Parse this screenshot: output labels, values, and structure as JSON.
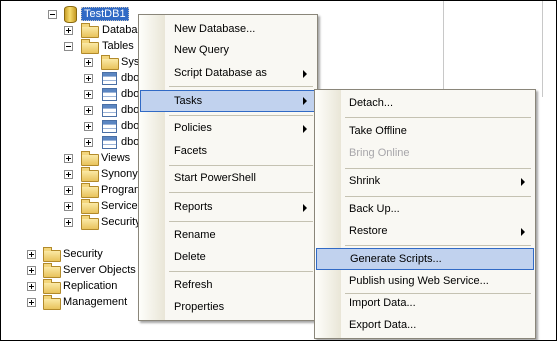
{
  "tree": {
    "db_name": "TestDB1",
    "children": [
      {
        "label": "Databa",
        "expander": "plus"
      },
      {
        "label": "Tables",
        "expander": "minus"
      },
      {
        "label": "Sys",
        "expander": "plus"
      },
      {
        "label": "dbo",
        "expander": "plus"
      },
      {
        "label": "dbo",
        "expander": "plus"
      },
      {
        "label": "dbo",
        "expander": "plus"
      },
      {
        "label": "dbo",
        "expander": "plus"
      },
      {
        "label": "dbo",
        "expander": "plus"
      },
      {
        "label": "Views",
        "expander": "plus"
      },
      {
        "label": "Synony",
        "expander": "plus"
      },
      {
        "label": "Progran",
        "expander": "plus"
      },
      {
        "label": "Service",
        "expander": "plus"
      },
      {
        "label": "Security",
        "expander": "plus"
      }
    ],
    "root_items": [
      "Security",
      "Server Objects",
      "Replication",
      "Management"
    ]
  },
  "context_menu": {
    "items": [
      {
        "label": "New Database...",
        "submenu": false,
        "highlighted": false
      },
      {
        "label": "New Query",
        "submenu": false,
        "highlighted": false
      },
      {
        "label": "Script Database as",
        "submenu": true,
        "highlighted": false
      },
      {
        "label": "Tasks",
        "submenu": true,
        "highlighted": true
      },
      {
        "label": "Policies",
        "submenu": true,
        "highlighted": false
      },
      {
        "label": "Facets",
        "submenu": false,
        "highlighted": false
      },
      {
        "label": "Start PowerShell",
        "submenu": false,
        "highlighted": false
      },
      {
        "label": "Reports",
        "submenu": true,
        "highlighted": false
      },
      {
        "label": "Rename",
        "submenu": false,
        "highlighted": false
      },
      {
        "label": "Delete",
        "submenu": false,
        "highlighted": false
      },
      {
        "label": "Refresh",
        "submenu": false,
        "highlighted": false
      },
      {
        "label": "Properties",
        "submenu": false,
        "highlighted": false
      }
    ]
  },
  "tasks_submenu": {
    "items": [
      {
        "label": "Detach...",
        "submenu": false,
        "disabled": false,
        "highlighted": false
      },
      {
        "label": "Take Offline",
        "submenu": false,
        "disabled": false,
        "highlighted": false
      },
      {
        "label": "Bring Online",
        "submenu": false,
        "disabled": true,
        "highlighted": false
      },
      {
        "label": "Shrink",
        "submenu": true,
        "disabled": false,
        "highlighted": false
      },
      {
        "label": "Back Up...",
        "submenu": false,
        "disabled": false,
        "highlighted": false
      },
      {
        "label": "Restore",
        "submenu": true,
        "disabled": false,
        "highlighted": false
      },
      {
        "label": "Generate Scripts...",
        "submenu": false,
        "disabled": false,
        "highlighted": true
      },
      {
        "label": "Publish using Web Service...",
        "submenu": false,
        "disabled": false,
        "highlighted": false
      },
      {
        "label": "Import Data...",
        "submenu": false,
        "disabled": false,
        "highlighted": false
      },
      {
        "label": "Export Data...",
        "submenu": false,
        "disabled": false,
        "highlighted": false
      }
    ]
  },
  "colors": {
    "selection": "#316ac5",
    "menu_highlight": "#c1d2ee",
    "menu_background": "#f9f8f3",
    "disabled_text": "#a7a6aa"
  }
}
